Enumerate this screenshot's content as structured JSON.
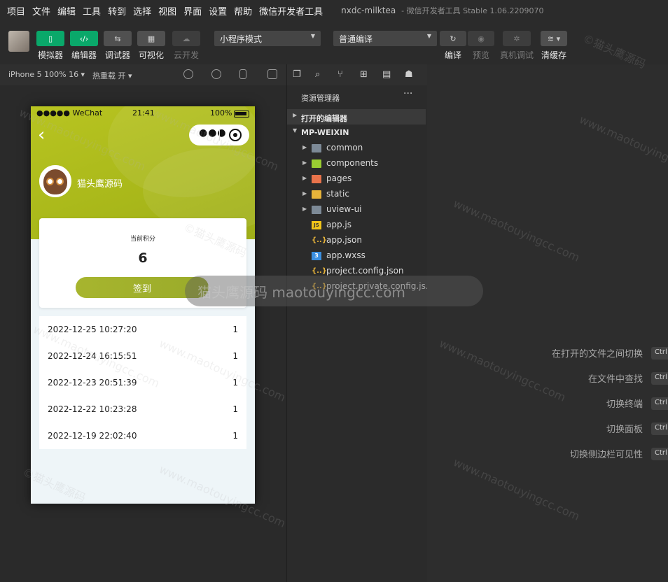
{
  "menu": {
    "items": [
      "项目",
      "文件",
      "编辑",
      "工具",
      "转到",
      "选择",
      "视图",
      "界面",
      "设置",
      "帮助",
      "微信开发者工具"
    ],
    "project": "nxdc-milktea",
    "app": "- 微信开发者工具 Stable 1.06.2209070"
  },
  "toolbar": {
    "simulator": "模拟器",
    "editor": "编辑器",
    "debugger": "调试器",
    "visual": "可视化",
    "cloud": "云开发",
    "mode_select": "小程序模式",
    "compile_select": "普通编译",
    "compile": "编译",
    "preview": "预览",
    "remote_debug": "真机调试",
    "clear_cache": "清缓存"
  },
  "simbar": {
    "device": "iPhone 5 100% 16 ▾",
    "hot_reload": "热重载 开 ▾"
  },
  "phone": {
    "carrier": "●●●●● WeChat",
    "time": "21:41",
    "battery": "100%",
    "user_name": "猫头鹰源码",
    "points_label": "当前积分",
    "points_value": "6",
    "signin": "签到",
    "records": [
      {
        "date": "2022-12-25 10:27:20",
        "value": "1"
      },
      {
        "date": "2022-12-24 16:15:51",
        "value": "1"
      },
      {
        "date": "2022-12-23 20:51:39",
        "value": "1"
      },
      {
        "date": "2022-12-22 10:23:28",
        "value": "1"
      },
      {
        "date": "2022-12-19 22:02:40",
        "value": "1"
      }
    ]
  },
  "explorer": {
    "title": "资源管理器",
    "more": "···",
    "open_editors": "打开的编辑器",
    "root": "MP-WEIXIN",
    "items": [
      {
        "name": "common",
        "type": "folder"
      },
      {
        "name": "components",
        "type": "folder-green"
      },
      {
        "name": "pages",
        "type": "folder-orange"
      },
      {
        "name": "static",
        "type": "folder-yellow"
      },
      {
        "name": "uview-ui",
        "type": "folder"
      },
      {
        "name": "app.js",
        "type": "js"
      },
      {
        "name": "app.json",
        "type": "json"
      },
      {
        "name": "app.wxss",
        "type": "css"
      },
      {
        "name": "project.config.json",
        "type": "json"
      },
      {
        "name": "project.private.config.js...",
        "type": "json"
      }
    ]
  },
  "shortcuts": [
    {
      "label": "在打开的文件之间切换",
      "key": "Ctrl"
    },
    {
      "label": "在文件中查找",
      "key": "Ctrl"
    },
    {
      "label": "切换终端",
      "key": "Ctrl"
    },
    {
      "label": "切换面板",
      "key": "Ctrl"
    },
    {
      "label": "切换侧边栏可见性",
      "key": "Ctrl"
    }
  ],
  "watermark": {
    "banner": "猫头鹰源码 maotouyingcc.com",
    "cn": "©猫头鹰源码",
    "url": "www.maotouyingcc.com"
  },
  "colors": {
    "accent_green": "#0aa86a",
    "header_lime": "#b8c421",
    "button_olive": "#a7b52e"
  }
}
